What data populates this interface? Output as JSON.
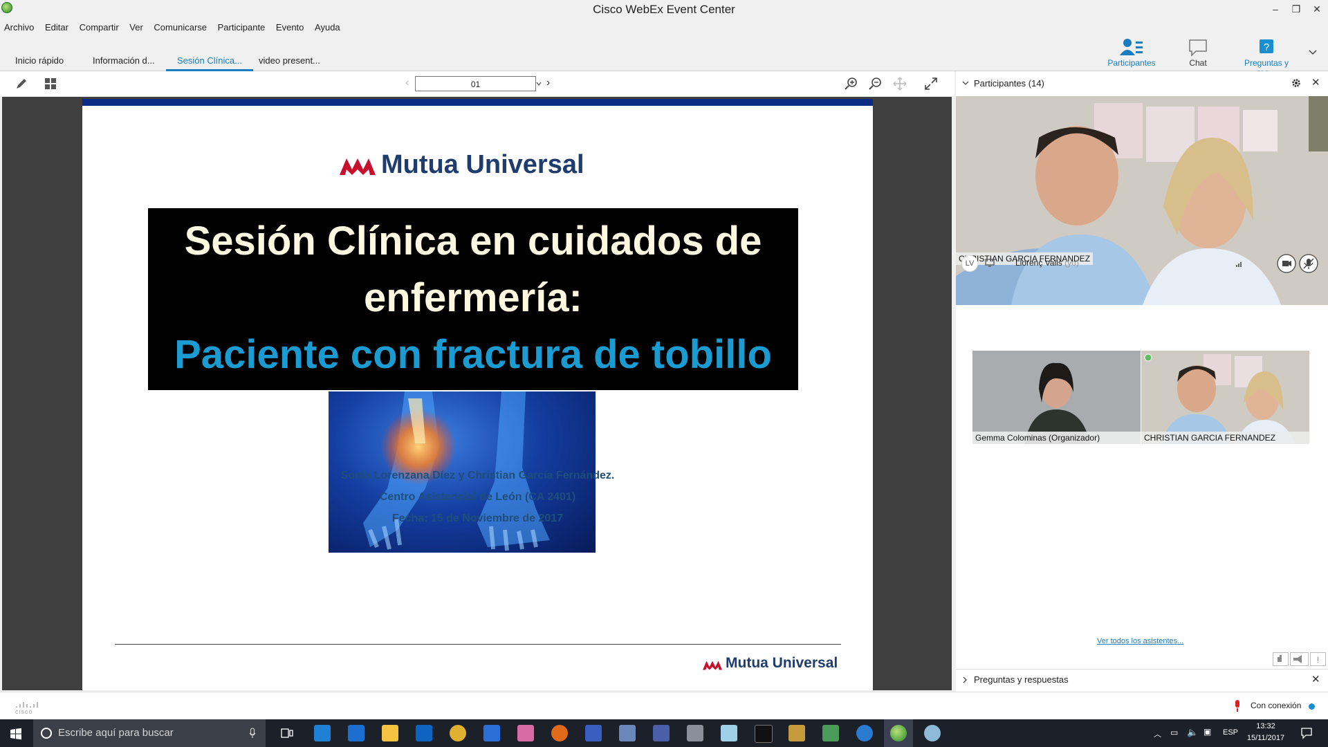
{
  "window": {
    "title": "Cisco WebEx Event Center",
    "min": "–",
    "max": "❐",
    "close": "✕"
  },
  "menu": [
    "Archivo",
    "Editar",
    "Compartir",
    "Ver",
    "Comunicarse",
    "Participante",
    "Evento",
    "Ayuda"
  ],
  "tabs": [
    {
      "label": "Inicio rápido",
      "active": false
    },
    {
      "label": "Información d...",
      "active": false
    },
    {
      "label": "Sesión Clínica...",
      "active": true
    },
    {
      "label": "video present...",
      "active": false
    }
  ],
  "panel_buttons": {
    "participants": "Participantes",
    "chat": "Chat",
    "qa": "Preguntas y res..."
  },
  "viewer": {
    "page": "01",
    "prev": "‹",
    "next": "›"
  },
  "slide": {
    "logo_text": "Mutua Universal",
    "title_line1": "Sesión Clínica en cuidados de",
    "title_line2": "enfermería:",
    "title_line3": "Paciente con fractura de tobillo",
    "authors": "Sonia Lorenzana Díez y Christian García Fernández.",
    "center": "Centro Asistencial de León (CA 2401)",
    "date": "Fecha: 15  de Noviembre de 2017",
    "footer_logo": "Mutua Universal"
  },
  "participants": {
    "header": "Participantes (14)",
    "main_video_label": "CHRISTIAN GARCIA FERNANDEZ",
    "me_initials": "LV",
    "me_name": "Llorenç Valls",
    "me_suffix": "(yo)",
    "thumbs": [
      {
        "label": "Gemma Colominas (Organizador)"
      },
      {
        "label": "CHRISTIAN GARCIA FERNANDEZ"
      }
    ],
    "see_all": "Ver todos los asistentes..."
  },
  "qa_section": {
    "header": "Preguntas y respuestas"
  },
  "status": {
    "connection": "Con conexión",
    "cisco": "cisco"
  },
  "taskbar": {
    "search_placeholder": "Escribe aquí para buscar",
    "lang": "ESP",
    "time": "13:32",
    "date": "15/11/2017"
  },
  "colors": {
    "accent": "#1a7dc0",
    "slide_blue": "#1a9bd1",
    "brand_red": "#c8102e",
    "brand_navy": "#1f3c6e"
  }
}
